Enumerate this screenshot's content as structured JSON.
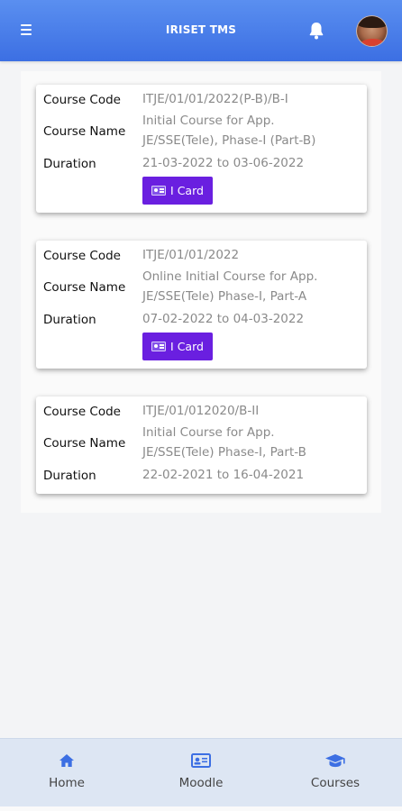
{
  "header": {
    "title": "IRISET TMS",
    "menu_icon": "hamburger-menu-icon",
    "bell_icon": "bell-icon",
    "avatar": "user-avatar",
    "bg_color": "#4a7fe9"
  },
  "courses": [
    {
      "code_label": "Course Code",
      "code": "ITJE/01/01/2022(P-B)/B-I",
      "name_label": "Course Name",
      "name_line1": "Initial Course for App.",
      "name_line2": "JE/SSE(Tele), Phase-I (Part-B)",
      "duration_label": "Duration",
      "duration": "21-03-2022 to 03-06-2022",
      "button_label": "I Card"
    },
    {
      "code_label": "Course Code",
      "code": "ITJE/01/01/2022",
      "name_label": "Course Name",
      "name_line1": "Online Initial Course for App.",
      "name_line2": "JE/SSE(Tele) Phase-I, Part-A",
      "duration_label": "Duration",
      "duration": "07-02-2022 to 04-03-2022",
      "button_label": "I Card"
    },
    {
      "code_label": "Course Code",
      "code": "ITJE/01/012020/B-II",
      "name_label": "Course Name",
      "name_line1": "Initial Course for App.",
      "name_line2": "JE/SSE(Tele) Phase-I, Part-B",
      "duration_label": "Duration",
      "duration": "22-02-2021 to 16-04-2021"
    }
  ],
  "bottom_nav": {
    "items": [
      {
        "label": "Home",
        "icon": "home-icon"
      },
      {
        "label": "Moodle",
        "icon": "id-card-icon"
      },
      {
        "label": "Courses",
        "icon": "graduation-cap-icon"
      }
    ],
    "accent_color": "#3c6fe3"
  },
  "button_color": "#6a1fe0"
}
